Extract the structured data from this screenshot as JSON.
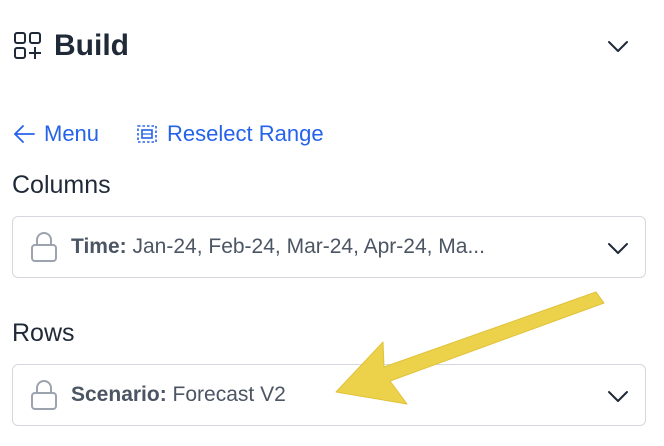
{
  "header": {
    "title": "Build"
  },
  "links": {
    "menu": "Menu",
    "reselect": "Reselect Range"
  },
  "columns": {
    "label": "Columns",
    "dimension": "Time:",
    "values": "Jan-24, Feb-24, Mar-24, Apr-24, Ma..."
  },
  "rows": {
    "label": "Rows",
    "dimension": "Scenario:",
    "values": "Forecast V2"
  },
  "colors": {
    "accent": "#2563eb",
    "annotation_arrow": "#ecd14a",
    "border": "#d4d8de"
  },
  "icons": {
    "build": "build-grid-plus-icon",
    "menu": "arrow-left-icon",
    "reselect": "select-range-icon",
    "lock": "lock-icon",
    "chevron": "chevron-down-icon"
  }
}
